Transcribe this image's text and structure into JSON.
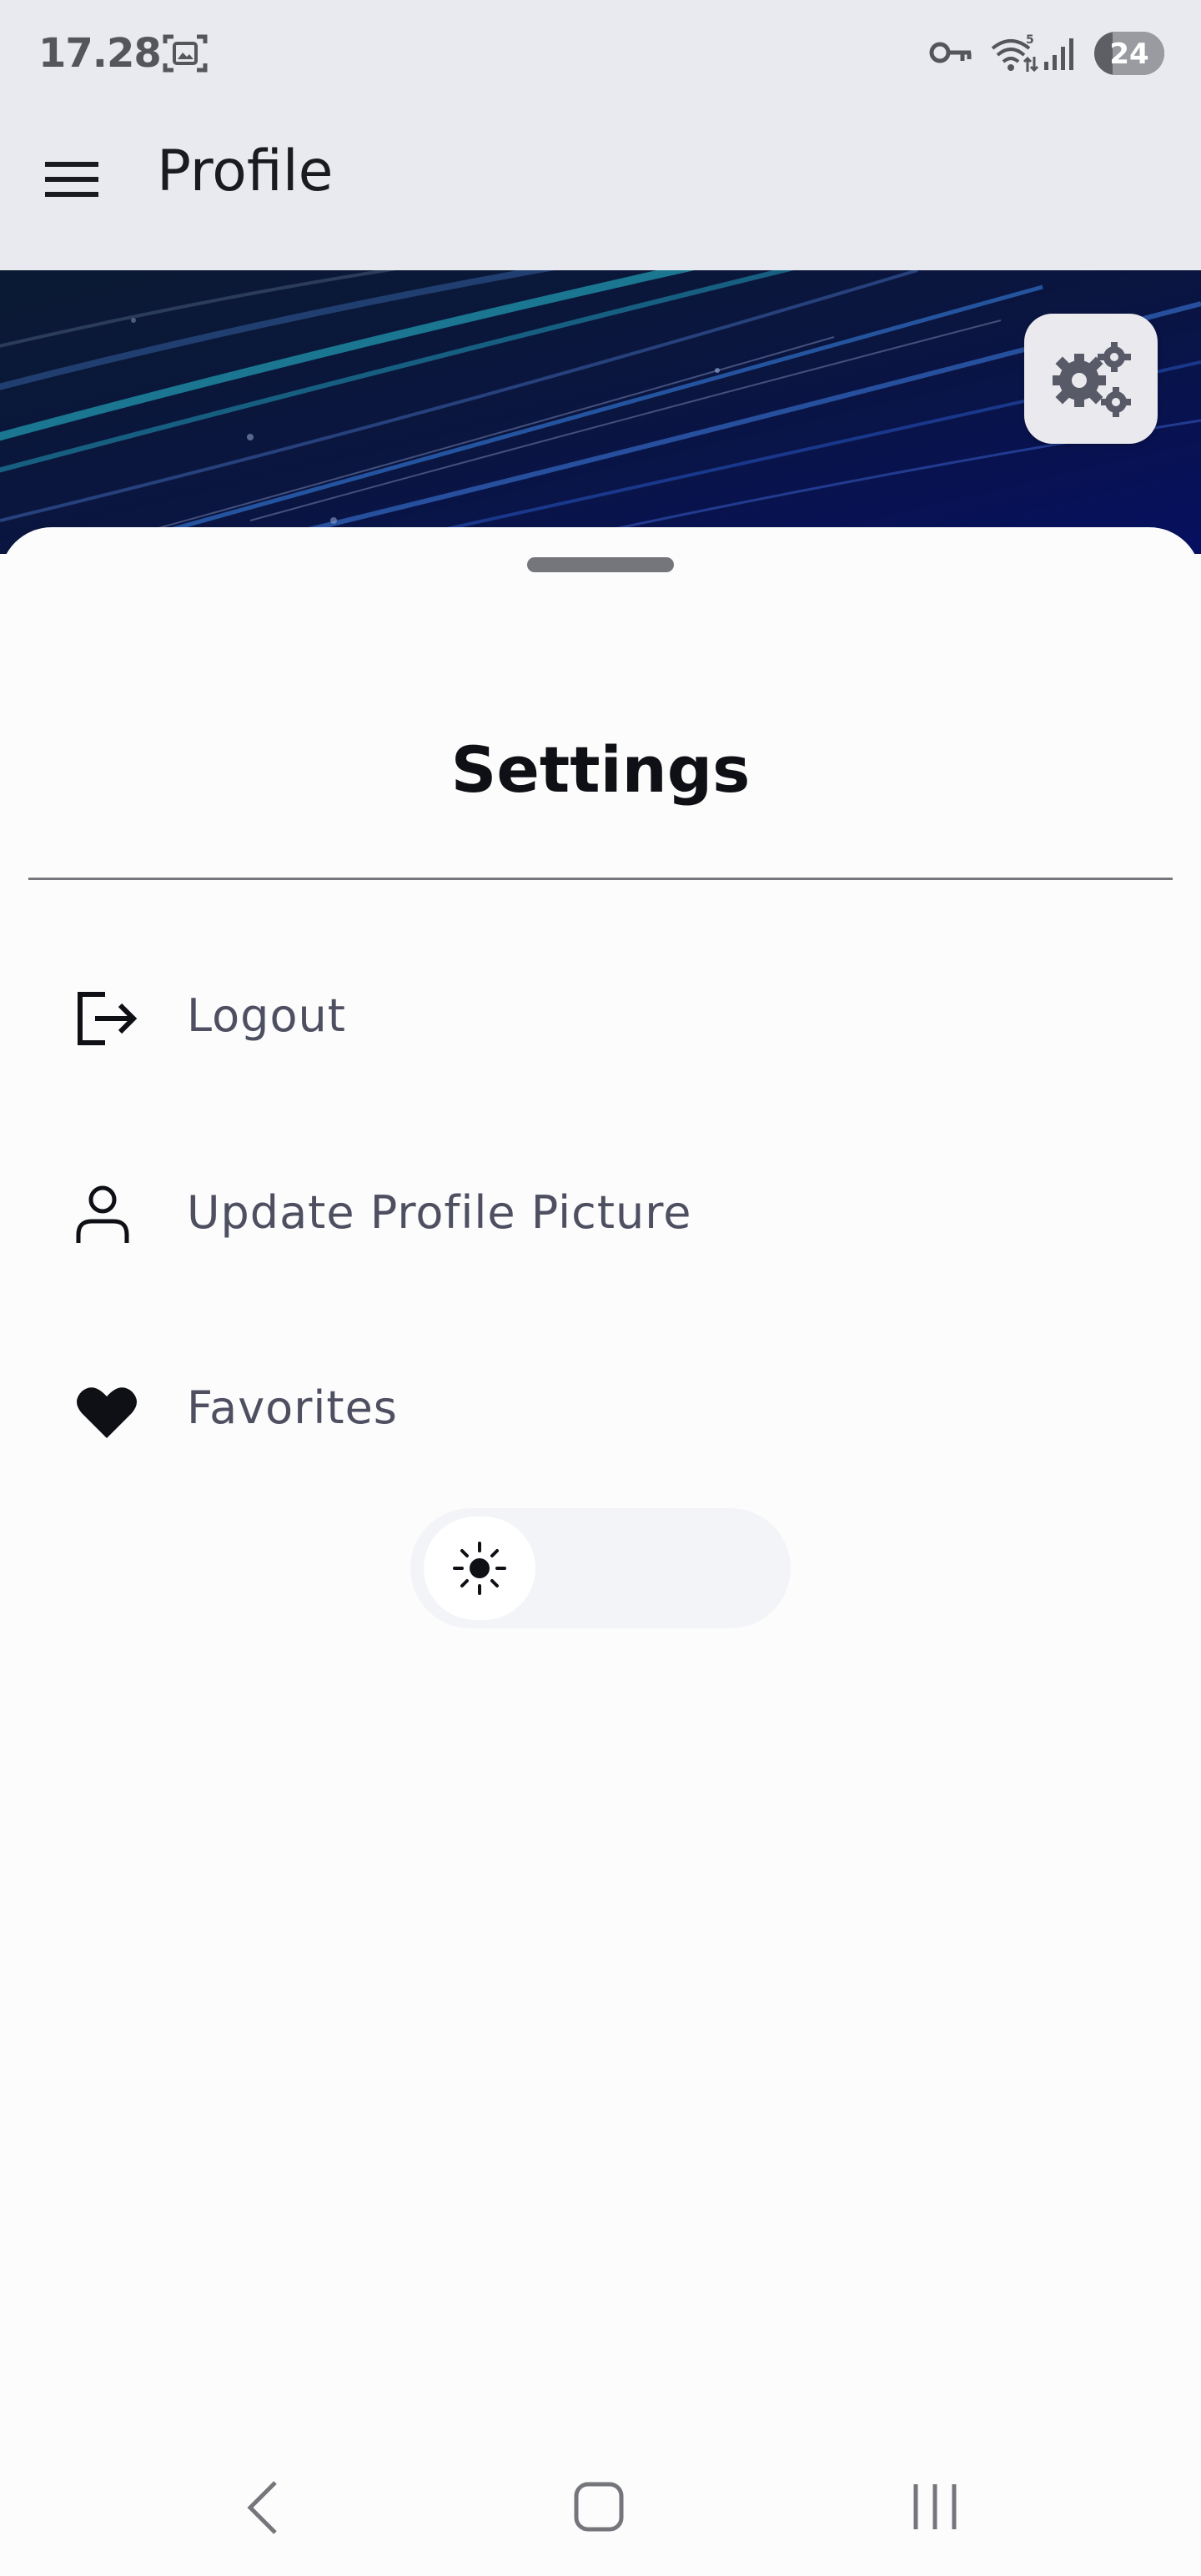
{
  "status_bar": {
    "time": "17.28",
    "battery": "24",
    "icons": [
      "screenshot-icon",
      "vpn-key-icon",
      "wifi-icon",
      "signal-icon",
      "battery-icon"
    ]
  },
  "app_bar": {
    "title": "Profile",
    "menu_icon": "menu-icon"
  },
  "header": {
    "fab_icon": "gears-icon"
  },
  "sheet": {
    "title": "Settings",
    "items": [
      {
        "label": "Logout",
        "icon": "logout-icon"
      },
      {
        "label": "Update Profile Picture",
        "icon": "person-icon"
      },
      {
        "label": "Favorites",
        "icon": "heart-icon"
      }
    ],
    "theme_toggle": {
      "icon": "sun-icon",
      "state": "light"
    }
  },
  "nav_bar": {
    "icons": [
      "back-icon",
      "home-icon",
      "recents-icon"
    ]
  },
  "colors": {
    "app_bar_bg": "#E9EAEF",
    "sheet_bg": "#FCFCFC",
    "item_text": "#4E5062",
    "title_text": "#0F1015",
    "header_bg": "#0A1230"
  }
}
